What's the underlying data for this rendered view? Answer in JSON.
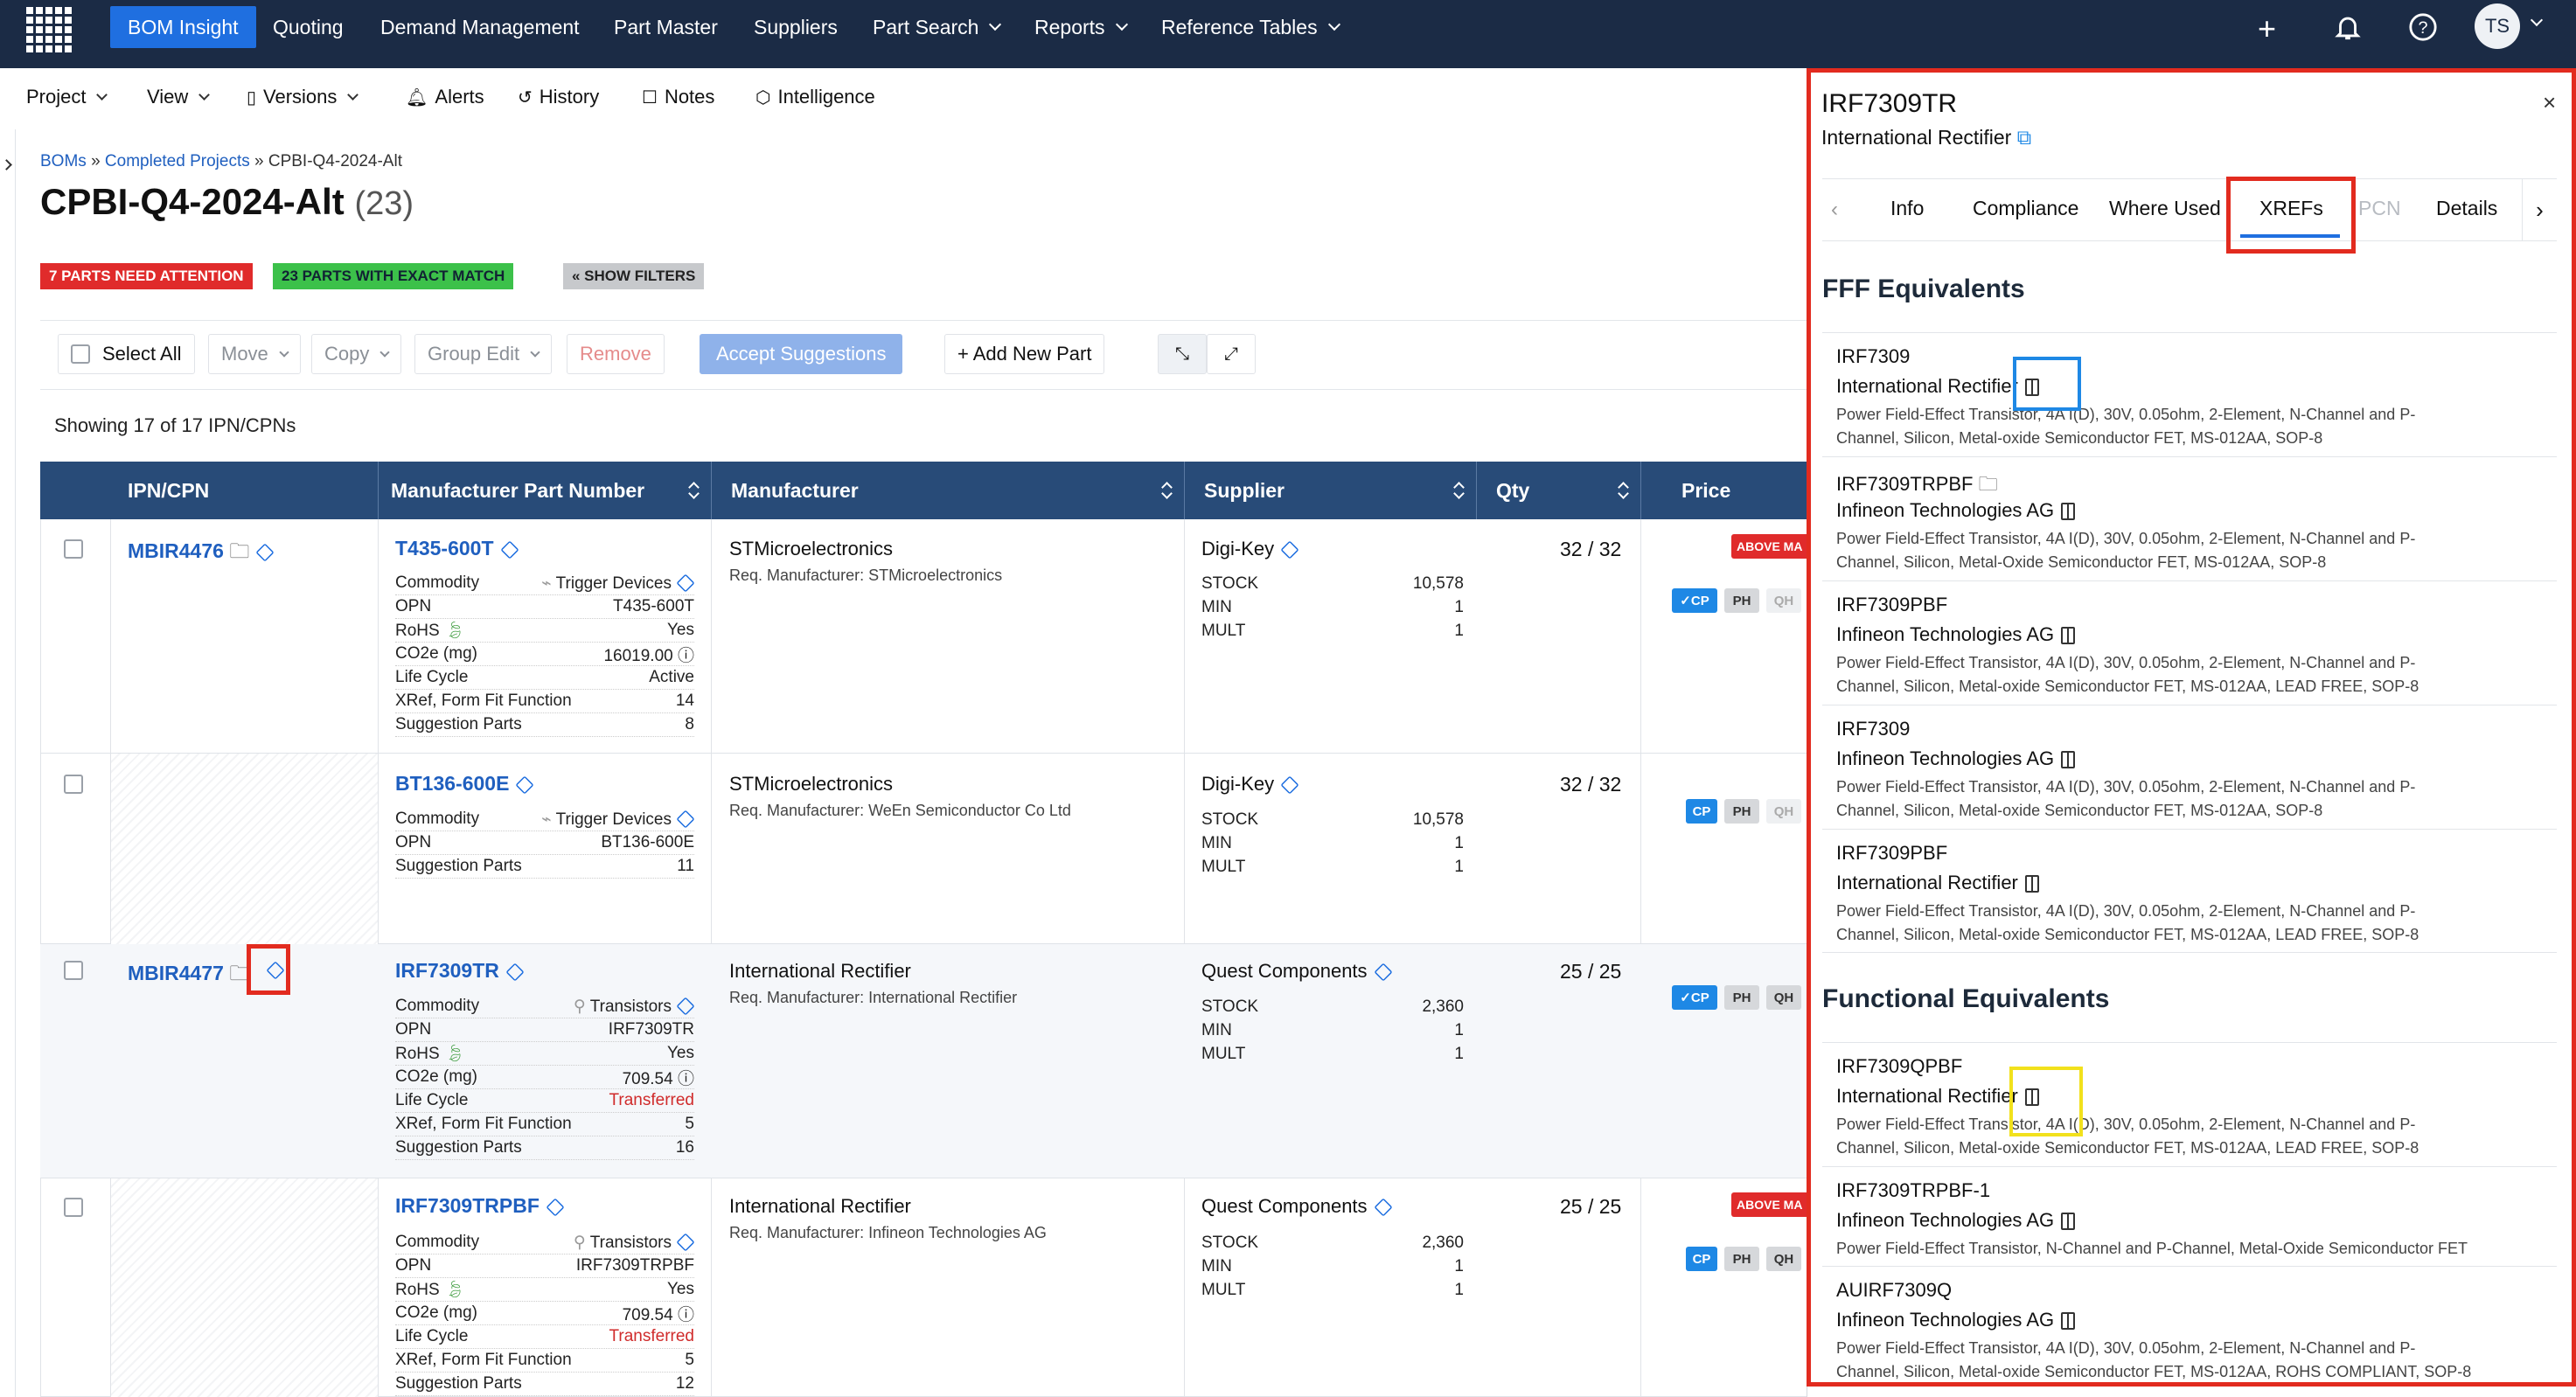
{
  "nav": {
    "items": [
      "BOM Insight",
      "Quoting",
      "Demand Management",
      "Part Master",
      "Suppliers",
      "Part Search",
      "Reports",
      "Reference Tables"
    ],
    "user_initials": "TS"
  },
  "subnav": {
    "project": "Project",
    "view": "View",
    "versions": "Versions",
    "alerts": "Alerts",
    "history": "History",
    "notes": "Notes",
    "intelligence": "Intelligence"
  },
  "breadcrumb": {
    "boms": "BOMs",
    "sep": "»",
    "completed": "Completed Projects",
    "current": "CPBI-Q4-2024-Alt"
  },
  "page": {
    "title": "CPBI-Q4-2024-Alt",
    "count": "(23)"
  },
  "badges": {
    "attention": "7 PARTS NEED ATTENTION",
    "exact": "23 PARTS WITH EXACT MATCH",
    "filters": "« SHOW FILTERS"
  },
  "toolbar": {
    "select_all": "Select All",
    "move": "Move",
    "copy": "Copy",
    "group_edit": "Group Edit",
    "remove": "Remove",
    "accept": "Accept Suggestions",
    "add": "+ Add New Part"
  },
  "showing": "Showing 17 of 17 IPN/CPNs",
  "table": {
    "headers": [
      "IPN/CPN",
      "Manufacturer Part Number",
      "Manufacturer",
      "Supplier",
      "Qty",
      "Price"
    ],
    "rows": [
      {
        "ipn": "MBIR4476",
        "mpn": "T435-600T",
        "mfr": "STMicroelectronics",
        "req": "Req. Manufacturer: STMicroelectronics",
        "supplier": "Digi-Key",
        "qty": "32 / 32",
        "above": "ABOVE MA",
        "attrs": [
          [
            "Commodity",
            "Trigger Devices"
          ],
          [
            "OPN",
            "T435-600T"
          ],
          [
            "RoHS",
            "Yes"
          ],
          [
            "CO2e (mg)",
            "16019.00"
          ],
          [
            "Life Cycle",
            "Active"
          ],
          [
            "XRef, Form Fit Function",
            "14"
          ],
          [
            "Suggestion Parts",
            "8"
          ]
        ],
        "stock": [
          [
            "STOCK",
            "10,578"
          ],
          [
            "MIN",
            "1"
          ],
          [
            "MULT",
            "1"
          ]
        ]
      },
      {
        "ipn": "",
        "mpn": "BT136-600E",
        "mfr": "STMicroelectronics",
        "req": "Req. Manufacturer: WeEn Semiconductor Co Ltd",
        "supplier": "Digi-Key",
        "qty": "32 / 32",
        "above": "",
        "attrs": [
          [
            "Commodity",
            "Trigger Devices"
          ],
          [
            "OPN",
            "BT136-600E"
          ],
          [
            "Suggestion Parts",
            "11"
          ]
        ],
        "stock": [
          [
            "STOCK",
            "10,578"
          ],
          [
            "MIN",
            "1"
          ],
          [
            "MULT",
            "1"
          ]
        ]
      },
      {
        "ipn": "MBIR4477",
        "mpn": "IRF7309TR",
        "mfr": "International Rectifier",
        "req": "Req. Manufacturer: International Rectifier",
        "supplier": "Quest Components",
        "qty": "25 / 25",
        "above": "",
        "attrs": [
          [
            "Commodity",
            "Transistors"
          ],
          [
            "OPN",
            "IRF7309TR"
          ],
          [
            "RoHS",
            "Yes"
          ],
          [
            "CO2e (mg)",
            "709.54"
          ],
          [
            "Life Cycle",
            "Transferred"
          ],
          [
            "XRef, Form Fit Function",
            "5"
          ],
          [
            "Suggestion Parts",
            "16"
          ]
        ],
        "stock": [
          [
            "STOCK",
            "2,360"
          ],
          [
            "MIN",
            "1"
          ],
          [
            "MULT",
            "1"
          ]
        ]
      },
      {
        "ipn": "",
        "mpn": "IRF7309TRPBF",
        "mfr": "International Rectifier",
        "req": "Req. Manufacturer: Infineon Technologies AG",
        "supplier": "Quest Components",
        "qty": "25 / 25",
        "above": "ABOVE MA",
        "attrs": [
          [
            "Commodity",
            "Transistors"
          ],
          [
            "OPN",
            "IRF7309TRPBF"
          ],
          [
            "RoHS",
            "Yes"
          ],
          [
            "CO2e (mg)",
            "709.54"
          ],
          [
            "Life Cycle",
            "Transferred"
          ],
          [
            "XRef, Form Fit Function",
            "5"
          ],
          [
            "Suggestion Parts",
            "12"
          ]
        ],
        "stock": [
          [
            "STOCK",
            "2,360"
          ],
          [
            "MIN",
            "1"
          ],
          [
            "MULT",
            "1"
          ]
        ]
      }
    ],
    "pills": {
      "cp": "CP",
      "cp_check": "✓CP",
      "ph": "PH",
      "qh": "QH"
    }
  },
  "panel": {
    "part": "IRF7309TR",
    "mfr": "International Rectifier",
    "tabs": [
      "Info",
      "Compliance",
      "Where Used",
      "XREFs",
      "PCN",
      "Details"
    ],
    "fff_title": "FFF Equivalents",
    "fff": [
      {
        "pn": "IRF7309",
        "mfr": "International Rectifier",
        "desc1": "Power Field-Effect Transistor, 4A I(D), 30V, 0.05ohm, 2-Element, N-Channel and P-",
        "desc2": "Channel, Silicon, Metal-oxide Semiconductor FET, MS-012AA, SOP-8"
      },
      {
        "pn": "IRF7309TRPBF",
        "mfr": "Infineon Technologies AG",
        "desc1": "Power Field-Effect Transistor, 4A I(D), 30V, 0.05ohm, 2-Element, N-Channel and P-",
        "desc2": "Channel, Silicon, Metal-Oxide Semiconductor FET, MS-012AA, SOP-8"
      },
      {
        "pn": "IRF7309PBF",
        "mfr": "Infineon Technologies AG",
        "desc1": "Power Field-Effect Transistor, 4A I(D), 30V, 0.05ohm, 2-Element, N-Channel and P-",
        "desc2": "Channel, Silicon, Metal-oxide Semiconductor FET, MS-012AA, LEAD FREE, SOP-8"
      },
      {
        "pn": "IRF7309",
        "mfr": "Infineon Technologies AG",
        "desc1": "Power Field-Effect Transistor, 4A I(D), 30V, 0.05ohm, 2-Element, N-Channel and P-",
        "desc2": "Channel, Silicon, Metal-oxide Semiconductor FET, MS-012AA, SOP-8"
      },
      {
        "pn": "IRF7309PBF",
        "mfr": "International Rectifier",
        "desc1": "Power Field-Effect Transistor, 4A I(D), 30V, 0.05ohm, 2-Element, N-Channel and P-",
        "desc2": "Channel, Silicon, Metal-oxide Semiconductor FET, MS-012AA, LEAD FREE, SOP-8"
      }
    ],
    "func_title": "Functional Equivalents",
    "func": [
      {
        "pn": "IRF7309QPBF",
        "mfr": "International Rectifier",
        "desc1": "Power Field-Effect Transistor, 4A I(D), 30V, 0.05ohm, 2-Element, N-Channel and P-",
        "desc2": "Channel, Silicon, Metal-oxide Semiconductor FET, MS-012AA, LEAD FREE, SOP-8"
      },
      {
        "pn": "IRF7309TRPBF-1",
        "mfr": "Infineon Technologies AG",
        "desc1": "Power Field-Effect Transistor, N-Channel and P-Channel, Metal-Oxide Semiconductor FET",
        "desc2": ""
      },
      {
        "pn": "AUIRF7309Q",
        "mfr": "Infineon Technologies AG",
        "desc1": "Power Field-Effect Transistor, 4A I(D), 30V, 0.05ohm, 2-Element, N-Channel and P-",
        "desc2": "Channel, Silicon, Metal-oxide Semiconductor FET, MS-012AA, ROHS COMPLIANT, SOP-8"
      }
    ]
  },
  "colors": {
    "nav_bg": "#1b2b45",
    "active": "#1f6fe0",
    "header_bg": "#284b78",
    "link": "#1f5fbf",
    "attention": "#e02b2b",
    "exact": "#3cc14a",
    "annotation_red": "#e22b1f",
    "annotation_blue": "#1e88e5",
    "annotation_yellow": "#f2e11c"
  }
}
